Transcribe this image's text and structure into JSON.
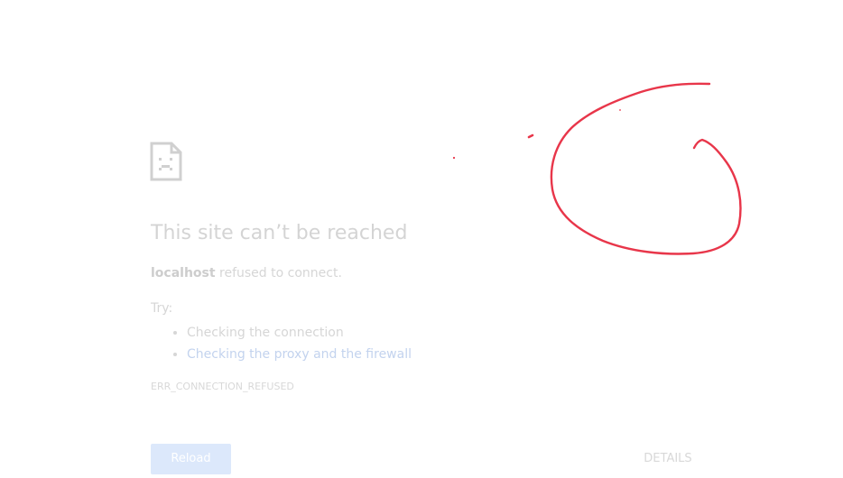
{
  "error_page": {
    "title": "This site can’t be reached",
    "host": "localhost",
    "message": " refused to connect.",
    "try_label": "Try:",
    "suggestions": [
      "Checking the connection",
      "Checking the proxy and the firewall"
    ],
    "error_code": "ERR_CONNECTION_REFUSED",
    "reload_label": "Reload",
    "details_label": "DETAILS"
  },
  "icons": {
    "error": "sad-document-icon"
  },
  "colors": {
    "annotation_stroke": "#e8364a",
    "reload_bg": "#dce8fb",
    "link": "#c3d3ee",
    "faded_text": "#d6d6d6"
  }
}
